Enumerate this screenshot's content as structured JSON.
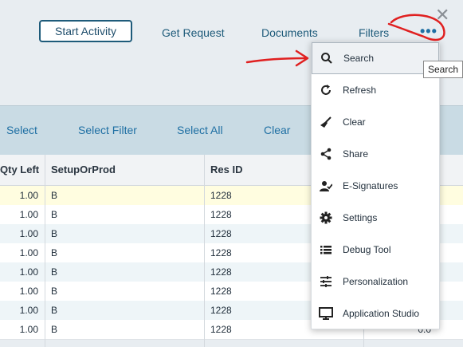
{
  "toolbar": {
    "start_activity": "Start Activity",
    "get_request": "Get Request",
    "documents": "Documents",
    "filters": "Filters",
    "more": "•••",
    "close": "✕"
  },
  "actions": {
    "select": "Select",
    "select_filter": "Select Filter",
    "select_all": "Select All",
    "clear": "Clear"
  },
  "table": {
    "headers": {
      "qty_left": "Qty Left",
      "setup": "SetupOrProd",
      "res_id": "Res ID"
    },
    "rows": [
      {
        "qty": "1.00",
        "setup": "B",
        "res": "1228",
        "last": ""
      },
      {
        "qty": "1.00",
        "setup": "B",
        "res": "1228",
        "last": ""
      },
      {
        "qty": "1.00",
        "setup": "B",
        "res": "1228",
        "last": ""
      },
      {
        "qty": "1.00",
        "setup": "B",
        "res": "1228",
        "last": ""
      },
      {
        "qty": "1.00",
        "setup": "B",
        "res": "1228",
        "last": ""
      },
      {
        "qty": "1.00",
        "setup": "B",
        "res": "1228",
        "last": ""
      },
      {
        "qty": "1.00",
        "setup": "B",
        "res": "1228",
        "last": ""
      },
      {
        "qty": "1.00",
        "setup": "B",
        "res": "1228",
        "last": "0.0"
      }
    ]
  },
  "menu": {
    "items": [
      {
        "label": "Search",
        "icon": "search-icon"
      },
      {
        "label": "Refresh",
        "icon": "refresh-icon"
      },
      {
        "label": "Clear",
        "icon": "broom-icon"
      },
      {
        "label": "Share",
        "icon": "share-icon"
      },
      {
        "label": "E-Signatures",
        "icon": "esignature-icon"
      },
      {
        "label": "Settings",
        "icon": "gear-icon"
      },
      {
        "label": "Debug Tool",
        "icon": "list-icon"
      },
      {
        "label": "Personalization",
        "icon": "sliders-icon"
      },
      {
        "label": "Application Studio",
        "icon": "monitor-icon"
      }
    ]
  },
  "tooltip": {
    "text": "Search"
  },
  "colors": {
    "accent": "#1e6fa3",
    "annotation": "#e02020",
    "action_row": "#c9dbe4",
    "selected_row": "#fffde0"
  }
}
